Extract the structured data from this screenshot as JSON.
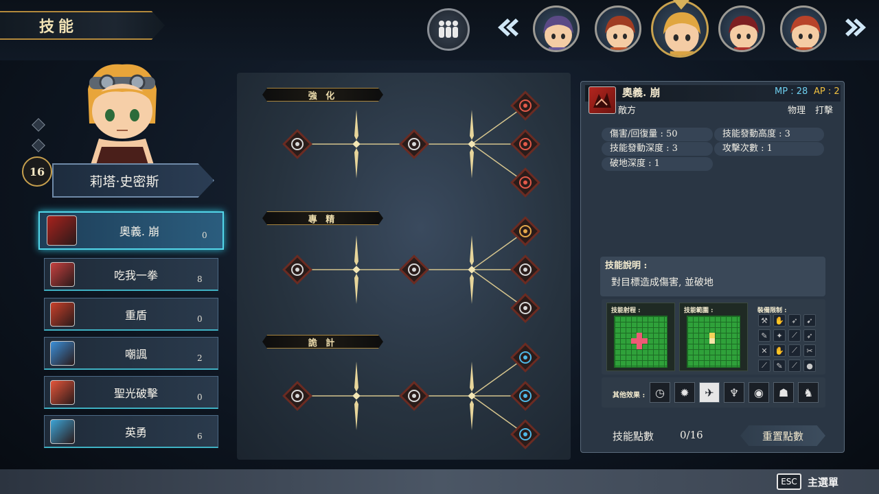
{
  "header": {
    "title": "技能"
  },
  "party": {
    "team_icon": "team-icon",
    "portraits": [
      {
        "color": "#6b5a9c",
        "hair": "#5b4a86"
      },
      {
        "color": "#c0552e",
        "hair": "#a03c22"
      },
      {
        "color": "#d9a344",
        "hair": "#e0a640"
      },
      {
        "color": "#b0342e",
        "hair": "#7d1f22"
      },
      {
        "color": "#c9532f",
        "hair": "#b8432a"
      }
    ],
    "active_index": 2
  },
  "character": {
    "level": "16",
    "name": "莉塔·史密斯"
  },
  "skills": [
    {
      "name": "奧義. 崩",
      "level": "0",
      "icon": "crumble-icon",
      "color": "#a8221d",
      "selected": true
    },
    {
      "name": "吃我一拳",
      "level": "8",
      "icon": "fist-icon",
      "color": "#c6403f"
    },
    {
      "name": "重盾",
      "level": "0",
      "icon": "shield-icon",
      "color": "#c9402a"
    },
    {
      "name": "嘲諷",
      "level": "2",
      "icon": "taunt-icon",
      "color": "#3b8fd8"
    },
    {
      "name": "聖光破擊",
      "level": "0",
      "icon": "holy-strike-icon",
      "color": "#e4553a"
    },
    {
      "name": "英勇",
      "level": "6",
      "icon": "valor-icon",
      "color": "#3da4d6"
    }
  ],
  "tree": {
    "sections": [
      {
        "label": "強 化"
      },
      {
        "label": "專 精"
      },
      {
        "label": "詭 計"
      }
    ]
  },
  "info": {
    "skill_name": "奧義. 崩",
    "mp": "MP : 28",
    "ap": "AP : 2",
    "target": "敵方",
    "type1": "物理",
    "type2": "打擊",
    "stats_left": [
      "傷害/回復量 : 50",
      "技能發動深度 : 3",
      "破地深度 : 1"
    ],
    "stats_right": [
      "技能發動高度 : 3",
      "攻擊次數 : 1"
    ],
    "desc_title": "技能說明 :",
    "desc_text": "對目標造成傷害, 並破地",
    "range_title": "技能射程 :",
    "area_title": "技能範圍 :",
    "equip_title": "裝備限制 :",
    "effects_title": "其他效果 :",
    "points_label": "技能點數",
    "points_value": "0/16",
    "reset_label": "重置點數"
  },
  "footer": {
    "esc": "ESC",
    "menu": "主選單"
  }
}
